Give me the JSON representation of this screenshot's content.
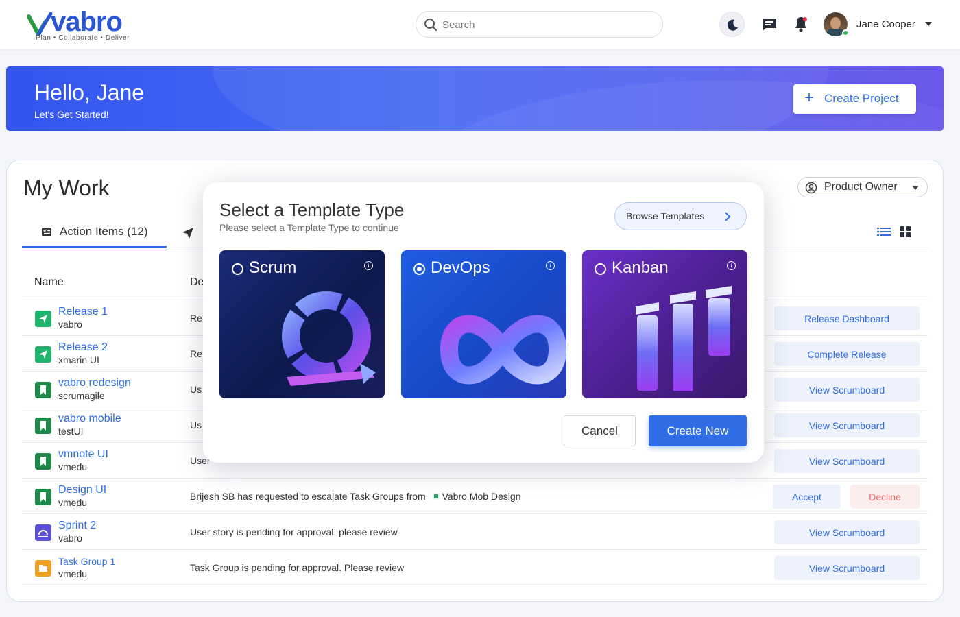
{
  "header": {
    "logo_text": "vabro",
    "logo_tagline": "Plan • Collaborate • Deliver",
    "search_placeholder": "Search",
    "user_name": "Jane Cooper"
  },
  "hero": {
    "greeting": "Hello, Jane",
    "subtitle": "Let's Get Started!",
    "create_button": "Create  Project"
  },
  "my_work": {
    "title": "My Work",
    "role_dropdown": "Product Owner",
    "tab_action_items": "Action Items (12)",
    "column_name": "Name",
    "column_description": "De",
    "rows": [
      {
        "title": "Release 1",
        "sub": "vabro",
        "desc": "Re",
        "action": "Release Dashboard",
        "icon": "release-icon"
      },
      {
        "title": "Release 2",
        "sub": "xmarin UI",
        "desc": "Re",
        "action": "Complete Release",
        "icon": "release-icon"
      },
      {
        "title": "vabro redesign",
        "sub": "scrumagile",
        "desc": "Us",
        "action": "View Scrumboard",
        "icon": "bookmark-icon"
      },
      {
        "title": "vabro mobile",
        "sub": "testUI",
        "desc": "Us",
        "action": "View Scrumboard",
        "icon": "bookmark-icon"
      },
      {
        "title": "vmnote UI",
        "sub": "vmedu",
        "desc": "User",
        "action": "View Scrumboard",
        "icon": "bookmark-icon"
      },
      {
        "title": "Design UI",
        "sub": "vmedu",
        "desc_prefix": "Brijesh SB",
        "desc": " has requested to escalate Task Groups from ",
        "desc_tag": "Vabro Mob Design",
        "accept": "Accept",
        "decline": "Decline",
        "icon": "bookmark-icon"
      },
      {
        "title": "Sprint 2",
        "sub": "vabro",
        "desc": "User story is pending for approval. please review",
        "action": "View Scrumboard",
        "icon": "sprint-icon"
      },
      {
        "title": "Task Group 1",
        "sub": "vmedu",
        "desc": "Task Group is pending for approval. Please review",
        "action": "View Scrumboard",
        "icon": "folder-icon"
      }
    ]
  },
  "modal": {
    "title": "Select a Template Type",
    "subtitle": "Please select a Template Type to continue",
    "browse_button": "Browse Templates",
    "cards": [
      {
        "label": "Scrum",
        "selected": false
      },
      {
        "label": "DevOps",
        "selected": true
      },
      {
        "label": "Kanban",
        "selected": false
      }
    ],
    "cancel": "Cancel",
    "create_new": "Create New"
  },
  "colors": {
    "accent": "#2f6ee6",
    "hero_start": "#3355ee",
    "hero_end": "#6a58ea",
    "release_green": "#1fb36b",
    "bookmark_green": "#1e8a4a",
    "sprint_purple": "#5b4fd6",
    "folder_orange": "#f0a020"
  }
}
